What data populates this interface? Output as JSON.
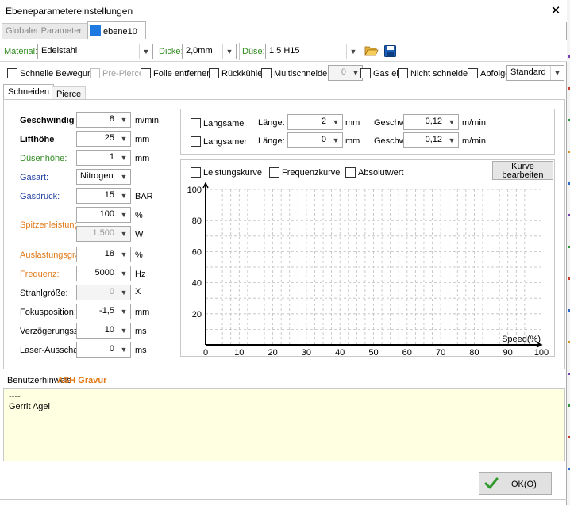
{
  "window": {
    "title": "Ebeneparametereinstellungen",
    "close_glyph": "✕"
  },
  "tabs": {
    "inactive": "Globaler Parameter",
    "active": "ebene10"
  },
  "toolbar": {
    "material_label": "Material:",
    "material_value": "Edelstahl",
    "dicke_label": "Dicke:",
    "dicke_value": "2,0mm",
    "duese_label": "Düse:",
    "duese_value": "1.5 H15",
    "open_icon": "folder-open-icon",
    "save_icon": "save-icon"
  },
  "options": {
    "schnelle_bewegung": "Schnelle Bewegung",
    "pre_pierce": "Pre-Pierce",
    "folie_entfernen": "Folie entfernen",
    "rueckkuehler": "Rückkühler",
    "multischneider": "Multischneider",
    "multischneider_value": "0",
    "gas_ein": "Gas ein",
    "nicht_schneiden": "Nicht schneiden",
    "abfolge": "Abfolge",
    "abfolge_value": "Standard"
  },
  "subtabs": {
    "schneiden": "Schneiden",
    "pierce": "Pierce"
  },
  "params": {
    "geschwindigkeit": {
      "label": "Geschwindig",
      "value": "8",
      "unit": "m/min"
    },
    "lifthoehe": {
      "label": "Lifthöhe",
      "value": "25",
      "unit": "mm"
    },
    "duesenhoehe": {
      "label": "Düsenhöhe:",
      "value": "1",
      "unit": "mm"
    },
    "gasart": {
      "label": "Gasart:",
      "value": "Nitrogen"
    },
    "gasdruck": {
      "label": "Gasdruck:",
      "value": "15",
      "unit": "BAR"
    },
    "spitzenleistung": {
      "label": "Spitzenleistung:",
      "value_percent": "100",
      "unit_percent": "%",
      "value_watt": "1.500",
      "unit_watt": "W"
    },
    "auslastungsgrad": {
      "label": "Auslastungsgra",
      "value": "18",
      "unit": "%"
    },
    "frequenz": {
      "label": "Frequenz:",
      "value": "5000",
      "unit": "Hz"
    },
    "strahlgroesse": {
      "label": "Strahlgröße:",
      "value": "0",
      "unit": "X"
    },
    "fokusposition": {
      "label": "Fokusposition:",
      "value": "-1,5",
      "unit": "mm"
    },
    "verzoegerung": {
      "label": "Verzögerungsz",
      "value": "10",
      "unit": "ms"
    },
    "laser_ausschalt": {
      "label": "Laser-Ausscha",
      "value": "0",
      "unit": "ms"
    }
  },
  "slow": {
    "langsame": {
      "label": "Langsame",
      "laenge_label": "Länge:",
      "laenge_value": "2",
      "laenge_unit": "mm",
      "gesch_label": "Geschw",
      "gesch_value": "0,12",
      "gesch_unit": "m/min"
    },
    "langsamer": {
      "label": "Langsamer",
      "laenge_label": "Länge:",
      "laenge_value": "0",
      "laenge_unit": "mm",
      "gesch_label": "Geschw",
      "gesch_value": "0,12",
      "gesch_unit": "m/min"
    }
  },
  "curve": {
    "leistungskurve": "Leistungskurve",
    "frequenzkurve": "Frequenzkurve",
    "absolutwert": "Absolutwert",
    "edit_button_line1": "Kurve",
    "edit_button_line2": "bearbeiten"
  },
  "chart_data": {
    "type": "line",
    "xlabel": "Speed(%)",
    "ylabel": "",
    "xlim": [
      0,
      100
    ],
    "ylim": [
      0,
      100
    ],
    "x_ticks": [
      "0",
      "10",
      "20",
      "30",
      "40",
      "50",
      "60",
      "70",
      "80",
      "90",
      "100"
    ],
    "y_ticks": [
      "20",
      "40",
      "60",
      "80",
      "100"
    ],
    "grid": true,
    "series": []
  },
  "notes": {
    "label": "Benutzerhinweis",
    "overlay": "ASH Gravur",
    "line1": "----",
    "line2": "Gerrit Agel"
  },
  "ok_button": {
    "label": "OK(O)"
  },
  "colors": {
    "accent_green": "#2f8a1f",
    "accent_blue": "#1f3f9f",
    "accent_orange": "#e07a1a",
    "notes_bg": "#ffffe1"
  }
}
